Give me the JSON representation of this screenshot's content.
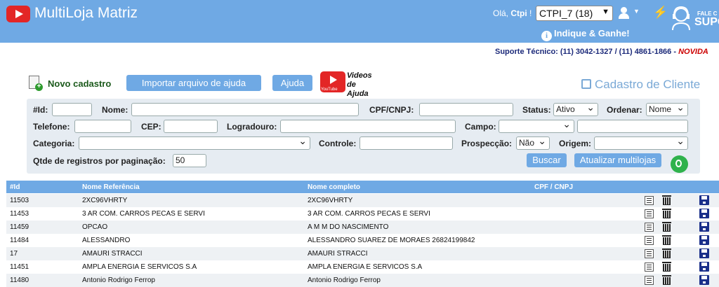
{
  "header": {
    "app_title": "MultiLoja Matriz",
    "greeting": "Olá,",
    "username": "Ctpi",
    "store_select": "CTPI_7 (18)",
    "referral": "Indique & Ganhe!",
    "support_small": "FALE C",
    "support_big": "SUPO",
    "support_line": "Suporte Técnico: (11) 3042-1327 / (11) 4861-1866 -",
    "novidades": "NOVIDA"
  },
  "toolbar": {
    "new_label": "Novo cadastro",
    "import_label": "Importar arquivo de ajuda",
    "help_label": "Ajuda",
    "videos_line1": "Videos",
    "videos_line2": "de Ajuda",
    "youtube": "YouTube",
    "page_title": "Cadastro de Cliente"
  },
  "filters": {
    "id_label": "#Id:",
    "name_label": "Nome:",
    "cpf_label": "CPF/CNPJ:",
    "status_label": "Status:",
    "status_value": "Ativo",
    "order_label": "Ordenar:",
    "order_value": "Nome",
    "phone_label": "Telefone:",
    "cep_label": "CEP:",
    "street_label": "Logradouro:",
    "field_label": "Campo:",
    "category_label": "Categoria:",
    "control_label": "Controle:",
    "prospect_label": "Prospecção:",
    "prospect_value": "Não",
    "origin_label": "Origem:",
    "per_page_label": "Qtde de registros por paginação:",
    "per_page_value": "50",
    "search_button": "Buscar",
    "update_button": "Atualizar multilojas"
  },
  "table": {
    "headers": [
      "#Id",
      "Nome Referência",
      "Nome completo",
      "CPF / CNPJ"
    ],
    "rows": [
      {
        "id": "11503",
        "ref": "2XC96VHRTY",
        "full": "2XC96VHRTY",
        "doc": ""
      },
      {
        "id": "11453",
        "ref": "3 AR COM. CARROS PECAS E SERVI",
        "full": "3 AR COM. CARROS PECAS E SERVI",
        "doc": ""
      },
      {
        "id": "11459",
        "ref": "OPCAO",
        "full": "A M M DO NASCIMENTO",
        "doc": ""
      },
      {
        "id": "11484",
        "ref": "ALESSANDRO",
        "full": "ALESSANDRO SUAREZ DE MORAES 26824199842",
        "doc": ""
      },
      {
        "id": "17",
        "ref": "AMAURI STRACCI",
        "full": "AMAURI STRACCI",
        "doc": ""
      },
      {
        "id": "11451",
        "ref": "AMPLA ENERGIA E SERVICOS S.A",
        "full": "AMPLA ENERGIA E SERVICOS S.A",
        "doc": ""
      },
      {
        "id": "11480",
        "ref": "Antonio Rodrigo Ferrop",
        "full": "Antonio Rodrigo Ferrop",
        "doc": ""
      }
    ]
  }
}
